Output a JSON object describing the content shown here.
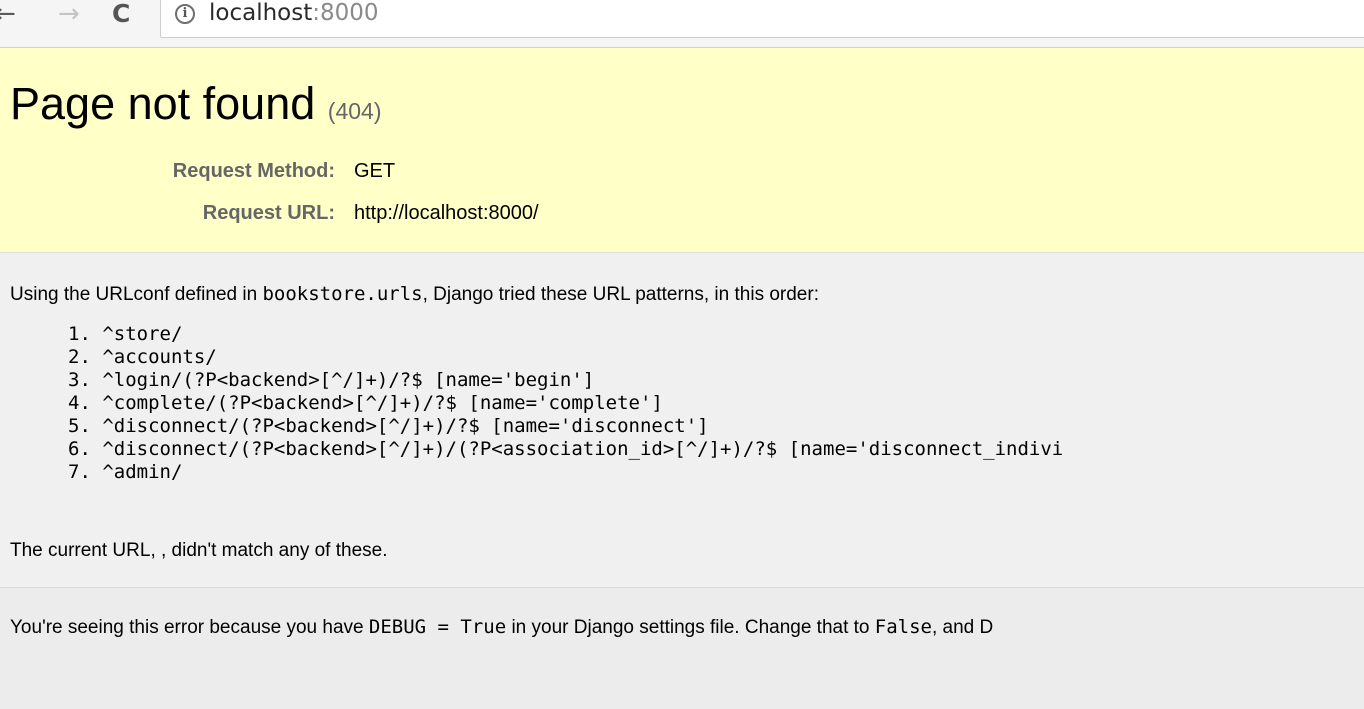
{
  "browser": {
    "back_glyph": "←",
    "forward_glyph": "→",
    "reload_glyph": "C",
    "info_glyph": "i",
    "url_host": "localhost",
    "url_port": ":8000"
  },
  "summary": {
    "title": "Page not found",
    "status": "(404)",
    "request_method_label": "Request Method:",
    "request_method_value": "GET",
    "request_url_label": "Request URL:",
    "request_url_value": "http://localhost:8000/"
  },
  "info": {
    "intro_before": "Using the URLconf defined in ",
    "intro_module": "bookstore.urls",
    "intro_after": ", Django tried these URL patterns, in this order:",
    "patterns": [
      {
        "num": "1.",
        "text": "^store/"
      },
      {
        "num": "2.",
        "text": "^accounts/"
      },
      {
        "num": "3.",
        "text": "^login/(?P<backend>[^/]+)/?$ [name='begin']"
      },
      {
        "num": "4.",
        "text": "^complete/(?P<backend>[^/]+)/?$ [name='complete']"
      },
      {
        "num": "5.",
        "text": "^disconnect/(?P<backend>[^/]+)/?$ [name='disconnect']"
      },
      {
        "num": "6.",
        "text": "^disconnect/(?P<backend>[^/]+)/(?P<association_id>[^/]+)/?$ [name='disconnect_indivi"
      },
      {
        "num": "7.",
        "text": "^admin/"
      }
    ],
    "no_match": "The current URL, , didn't match any of these."
  },
  "explanation": {
    "text_before": "You're seeing this error because you have ",
    "debug_code": "DEBUG = True",
    "text_middle": " in your Django settings file. Change that to ",
    "false_code": "False",
    "text_after": ", and D"
  }
}
